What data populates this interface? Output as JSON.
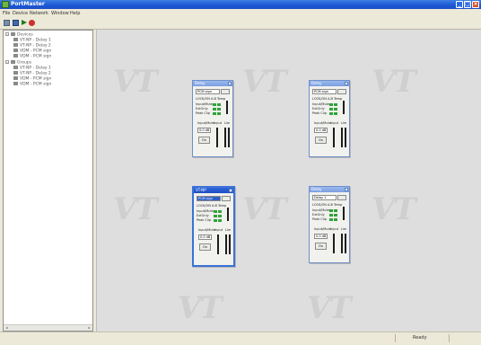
{
  "window": {
    "title": "PortMaster"
  },
  "menu": [
    "File",
    "Device",
    "Network",
    "Window",
    "Help"
  ],
  "toolbar": [
    "open-icon",
    "save-icon",
    "play-icon",
    "record-icon"
  ],
  "tree": {
    "groups": [
      {
        "label": "Devices",
        "items": [
          "VT-NP - Delay 1",
          "VT-NP - Delay 2",
          "VDM - PCM sign",
          "VDM - PCM sign"
        ]
      },
      {
        "label": "Groups",
        "items": [
          "VT-NP - Delay 1",
          "VT-NP - Delay 2",
          "VDM - PCM sign",
          "VDM - PCM sign"
        ]
      }
    ]
  },
  "panels": [
    {
      "title": "Delay",
      "select": "PCM sign",
      "header": "LOCK/ON  A-B  Temp",
      "rows": [
        "Input/Mute",
        "ExtOnly",
        "Peak Clip"
      ],
      "level_labels": [
        "Input/Mute",
        "Input",
        "Lim"
      ],
      "field": "0.0 dB",
      "button": "On",
      "selected": false
    },
    {
      "title": "Delay",
      "select": "PCM sign",
      "header": "LOCK/ON  A-B  Temp",
      "rows": [
        "Input/Mute",
        "ExtOnly",
        "Peak Clip"
      ],
      "level_labels": [
        "Input/Mute",
        "Input",
        "Lim"
      ],
      "field": "0.0 dB",
      "button": "On",
      "selected": false
    },
    {
      "title": "VT-NP",
      "select": "PCM sign",
      "header": "LOCK/ON  A-B  Temp",
      "rows": [
        "Input/Mute",
        "ExtOnly",
        "Peak Clip"
      ],
      "level_labels": [
        "Input/Mute",
        "Input",
        "Lim"
      ],
      "field": "0.0 dB",
      "button": "On",
      "selected": true
    },
    {
      "title": "Delay",
      "select": "Delay 1",
      "header": "LOCK/ON  A-B  Temp",
      "rows": [
        "Input/Mute",
        "ExtOnly",
        "Peak Clip"
      ],
      "level_labels": [
        "Input/Mute",
        "Input",
        "Lim"
      ],
      "field": "0.0 dB",
      "button": "On",
      "selected": false
    }
  ],
  "watermark": "VT",
  "status": {
    "text": "Ready"
  }
}
